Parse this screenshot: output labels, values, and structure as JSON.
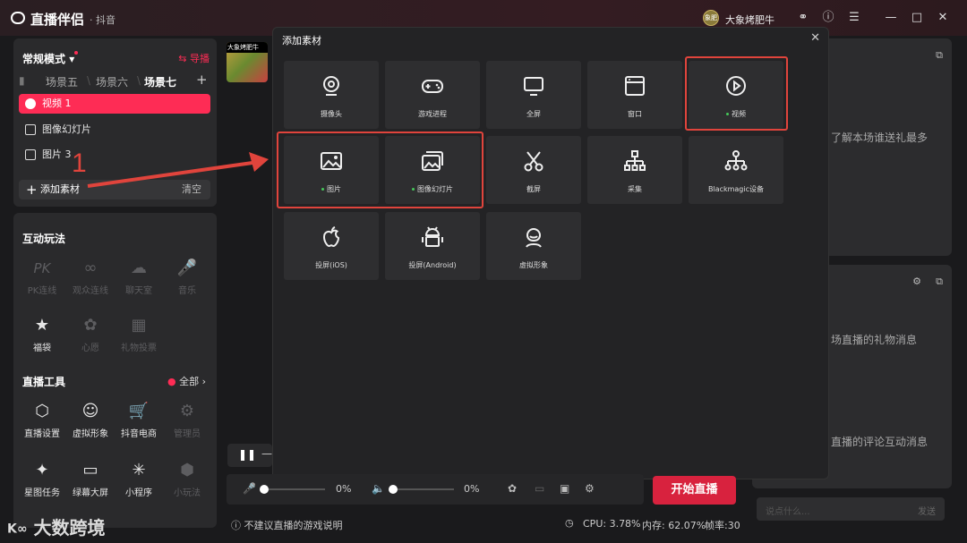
{
  "titlebar": {
    "app_name": "直播伴侣",
    "platform": "· 抖音",
    "user_name": "大象烤肥牛",
    "avatar_text": "象肥",
    "icons": [
      "headset-icon",
      "help-icon",
      "menu-icon",
      "minimize-icon",
      "maximize-icon",
      "close-icon"
    ]
  },
  "scene_panel": {
    "mode": "常规模式",
    "guide": "导播",
    "tabs": [
      "场景五",
      "场景六",
      "场景七"
    ],
    "sources": [
      {
        "label": "视频 1",
        "active": true
      },
      {
        "label": "图像幻灯片",
        "active": false
      },
      {
        "label": "图片 3",
        "active": false
      }
    ],
    "add_label": "添加素材",
    "clear_label": "清空"
  },
  "annotation": {
    "number": "1"
  },
  "thumb_text": "大象烤肥牛",
  "interaction": {
    "title": "互动玩法",
    "items": [
      {
        "label": "PK连线",
        "icon": "pk-icon",
        "enabled": false
      },
      {
        "label": "观众连线",
        "icon": "link-icon",
        "enabled": false
      },
      {
        "label": "聊天室",
        "icon": "chat-icon",
        "enabled": false
      },
      {
        "label": "音乐",
        "icon": "mic-icon",
        "enabled": false
      },
      {
        "label": "福袋",
        "icon": "lucky-bag-icon",
        "enabled": true
      },
      {
        "label": "心愿",
        "icon": "wish-icon",
        "enabled": false
      },
      {
        "label": "礼物投票",
        "icon": "vote-icon",
        "enabled": false
      }
    ]
  },
  "tools": {
    "title": "直播工具",
    "all_label": "全部",
    "items": [
      {
        "label": "直播设置",
        "icon": "settings-icon",
        "enabled": true
      },
      {
        "label": "虚拟形象",
        "icon": "avatar-icon",
        "enabled": true
      },
      {
        "label": "抖音电商",
        "icon": "cart-icon",
        "enabled": true
      },
      {
        "label": "管理员",
        "icon": "admin-icon",
        "enabled": false
      },
      {
        "label": "星图任务",
        "icon": "star-task-icon",
        "enabled": true
      },
      {
        "label": "绿幕大屏",
        "icon": "green-screen-icon",
        "enabled": true
      },
      {
        "label": "小程序",
        "icon": "mini-program-icon",
        "enabled": true
      },
      {
        "label": "小玩法",
        "icon": "mini-game-icon",
        "enabled": false
      }
    ]
  },
  "dialog": {
    "title": "添加素材",
    "tiles": [
      {
        "label": "摄像头",
        "icon": "camera-icon",
        "dot": false
      },
      {
        "label": "游戏进程",
        "icon": "gamepad-icon",
        "dot": false
      },
      {
        "label": "全屏",
        "icon": "monitor-icon",
        "dot": false
      },
      {
        "label": "窗口",
        "icon": "window-icon",
        "dot": false
      },
      {
        "label": "视频",
        "icon": "play-icon",
        "dot": true
      },
      {
        "label": "图片",
        "icon": "image-icon",
        "dot": true
      },
      {
        "label": "图像幻灯片",
        "icon": "slideshow-icon",
        "dot": true
      },
      {
        "label": "截屏",
        "icon": "scissors-icon",
        "dot": false
      },
      {
        "label": "采集",
        "icon": "capture-icon",
        "dot": false
      },
      {
        "label": "Blackmagic设备",
        "icon": "blackmagic-icon",
        "dot": false
      },
      {
        "label": "投屏(iOS)",
        "icon": "apple-icon",
        "dot": false
      },
      {
        "label": "投屏(Android)",
        "icon": "android-icon",
        "dot": false
      },
      {
        "label": "虚拟形象",
        "icon": "virtual-avatar-icon",
        "dot": false
      }
    ]
  },
  "right": {
    "text1": "了解本场谁送礼最多",
    "text2": "场直播的礼物消息",
    "text3": "直播的评论互动消息",
    "chat_placeholder": "说点什么...",
    "send_label": "发送"
  },
  "bottom": {
    "mic_pct": "0%",
    "speaker_pct": "0%",
    "start_label": "开始直播",
    "warning": "不建议直播的游戏说明",
    "cpu": "CPU: 3.78%",
    "mem": "内存: 62.07%",
    "fps": "帧率:30"
  },
  "watermark": "大数跨境"
}
